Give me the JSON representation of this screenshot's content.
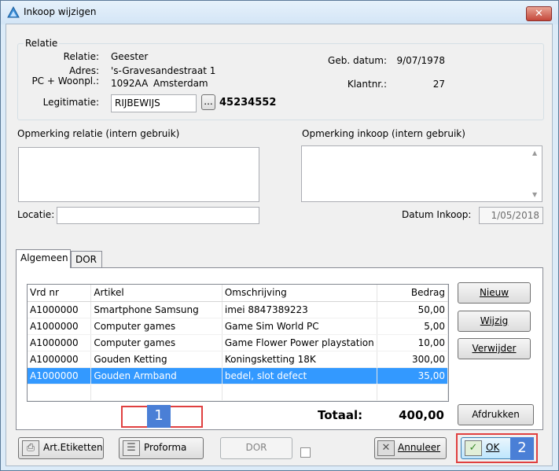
{
  "window": {
    "title": "Inkoop wijzigen",
    "close": "✕"
  },
  "relatie": {
    "legend": "Relatie",
    "labels": {
      "relatie": "Relatie:",
      "adres": "Adres:",
      "pc": "PC + Woonpl.:",
      "legitimatie": "Legitimatie:",
      "geb": "Geb. datum:",
      "klantnr": "Klantnr.:"
    },
    "relatie": "Geester",
    "adres": "'s-Gravesandestraat 1",
    "postcode": "1092AA",
    "woonplaats": "Amsterdam",
    "legitimatie": "RIJBEWIJS",
    "legitimatie_nr": "45234552",
    "browse": "...",
    "geb_datum": "9/07/1978",
    "klantnr": "27"
  },
  "opmerkingen": {
    "relatie_label": "Opmerking relatie (intern gebruik)",
    "inkoop_label": "Opmerking inkoop (intern gebruik)",
    "locatie_label": "Locatie:",
    "datum_label": "Datum Inkoop:",
    "datum": "1/05/2018"
  },
  "tabs": {
    "algemeen": "Algemeen",
    "dor": "DOR"
  },
  "table": {
    "headers": [
      "Vrd nr",
      "Artikel",
      "Omschrijving",
      "Bedrag"
    ],
    "rows": [
      [
        "A1000000",
        "Smartphone Samsung",
        "imei 8847389223",
        "50,00"
      ],
      [
        "A1000000",
        "Computer games",
        "Game Sim World PC",
        "5,00"
      ],
      [
        "A1000000",
        "Computer games",
        "Game Flower Power playstation",
        "10,00"
      ],
      [
        "A1000000",
        "Gouden Ketting",
        "Koningsketting 18K",
        "300,00"
      ],
      [
        "A1000000",
        "Gouden Armband",
        "bedel, slot defect",
        "35,00"
      ]
    ]
  },
  "side_buttons": {
    "nieuw": "Nieuw",
    "wijzig": "Wijzig",
    "verwijder": "Verwijder",
    "afdrukken": "Afdrukken"
  },
  "totaal": {
    "label": "Totaal:",
    "value": "400,00"
  },
  "bottom": {
    "etiketten": "Art.Etiketten",
    "proforma": "Proforma",
    "dor": "DOR",
    "annuleer": "Annuleer",
    "ok": "OK"
  },
  "callouts": {
    "one": "1",
    "two": "2"
  },
  "colors": {
    "selection": "#3399ff",
    "callout_border": "#e04040",
    "callout_badge": "#4a7fd6"
  }
}
